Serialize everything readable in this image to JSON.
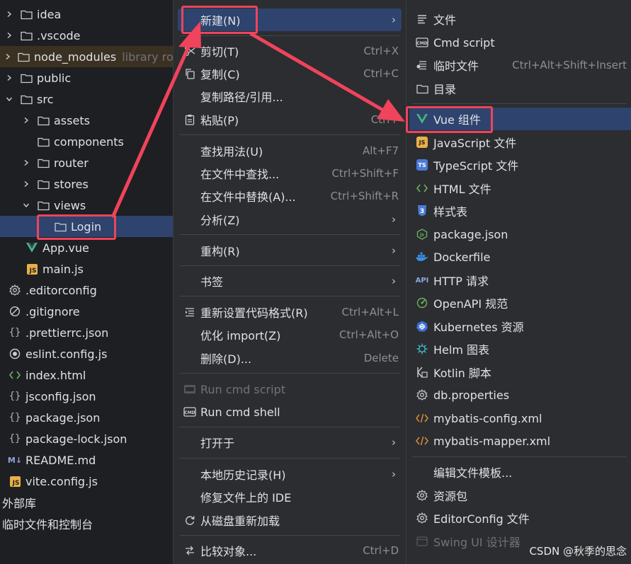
{
  "tree": {
    "items": [
      {
        "label": "idea",
        "type": "folder",
        "indent": 0,
        "expand": "collapsed"
      },
      {
        "label": ".vscode",
        "type": "folder",
        "indent": 0,
        "expand": "collapsed"
      },
      {
        "label": "node_modules",
        "note": "library ro",
        "type": "folder",
        "indent": 0,
        "expand": "collapsed"
      },
      {
        "label": "public",
        "type": "folder",
        "indent": 0,
        "expand": "collapsed"
      },
      {
        "label": "src",
        "type": "folder",
        "indent": 0,
        "expand": "expanded"
      },
      {
        "label": "assets",
        "type": "folder",
        "indent": 1,
        "expand": "collapsed"
      },
      {
        "label": "components",
        "type": "folder",
        "indent": 1,
        "expand": "none"
      },
      {
        "label": "router",
        "type": "folder",
        "indent": 1,
        "expand": "collapsed"
      },
      {
        "label": "stores",
        "type": "folder",
        "indent": 1,
        "expand": "collapsed"
      },
      {
        "label": "views",
        "type": "folder",
        "indent": 1,
        "expand": "expanded"
      },
      {
        "label": "Login",
        "type": "folder",
        "indent": 2,
        "expand": "none"
      },
      {
        "label": "App.vue",
        "type": "vue",
        "indent": 1,
        "expand": "none"
      },
      {
        "label": "main.js",
        "type": "js",
        "indent": 1,
        "expand": "none"
      },
      {
        "label": ".editorconfig",
        "type": "gear",
        "indent": 0,
        "expand": "none"
      },
      {
        "label": ".gitignore",
        "type": "ignore",
        "indent": 0,
        "expand": "none"
      },
      {
        "label": ".prettierrc.json",
        "type": "json",
        "indent": 0,
        "expand": "none"
      },
      {
        "label": "eslint.config.js",
        "type": "eslint",
        "indent": 0,
        "expand": "none"
      },
      {
        "label": "index.html",
        "type": "html",
        "indent": 0,
        "expand": "none"
      },
      {
        "label": "jsconfig.json",
        "type": "json",
        "indent": 0,
        "expand": "none"
      },
      {
        "label": "package.json",
        "type": "json",
        "indent": 0,
        "expand": "none"
      },
      {
        "label": "package-lock.json",
        "type": "json",
        "indent": 0,
        "expand": "none"
      },
      {
        "label": "README.md",
        "type": "md",
        "indent": 0,
        "expand": "none"
      },
      {
        "label": "vite.config.js",
        "type": "js",
        "indent": 0,
        "expand": "none"
      }
    ],
    "external_libraries": "外部库",
    "scratches": "临时文件和控制台"
  },
  "menu": {
    "new": "新建(N)",
    "cut": "剪切(T)",
    "cut_sc": "Ctrl+X",
    "copy": "复制(C)",
    "copy_sc": "Ctrl+C",
    "copy_path": "复制路径/引用...",
    "paste": "粘贴(P)",
    "paste_sc": "Ctrl+",
    "find_usages": "查找用法(U)",
    "find_usages_sc": "Alt+F7",
    "find_in_files": "在文件中查找...",
    "find_in_files_sc": "Ctrl+Shift+F",
    "replace_in_files": "在文件中替换(A)...",
    "replace_in_files_sc": "Ctrl+Shift+R",
    "analyze": "分析(Z)",
    "refactor": "重构(R)",
    "bookmarks": "书签",
    "reformat": "重新设置代码格式(R)",
    "reformat_sc": "Ctrl+Alt+L",
    "optimize_imports": "优化 import(Z)",
    "optimize_imports_sc": "Ctrl+Alt+O",
    "delete": "删除(D)...",
    "delete_sc": "Delete",
    "run_cmd_script": "Run cmd script",
    "run_cmd_shell": "Run cmd shell",
    "open_in": "打开于",
    "local_history": "本地历史记录(H)",
    "repair_ide": "修复文件上的 IDE",
    "reload": "从磁盘重新加载",
    "compare_with": "比较对象...",
    "compare_with_sc": "Ctrl+D",
    "arrow": "›"
  },
  "submenu": {
    "file": "文件",
    "cmd_script": "Cmd script",
    "scratch": "临时文件",
    "scratch_sc": "Ctrl+Alt+Shift+Insert",
    "directory": "目录",
    "vue": "Vue 组件",
    "javascript": "JavaScript 文件",
    "typescript": "TypeScript 文件",
    "html": "HTML 文件",
    "stylesheet": "样式表",
    "package_json": "package.json",
    "dockerfile": "Dockerfile",
    "http": "HTTP 请求",
    "openapi": "OpenAPI 规范",
    "kubernetes": "Kubernetes 资源",
    "helm": "Helm 图表",
    "kotlin": "Kotlin 脚本",
    "db_properties": "db.properties",
    "mybatis_config": "mybatis-config.xml",
    "mybatis_mapper": "mybatis-mapper.xml",
    "edit_templates": "编辑文件模板...",
    "resource_bundle": "资源包",
    "editorconfig": "EditorConfig 文件",
    "swing": "Swing UI 设计器"
  },
  "icons": {
    "js_badge": "JS",
    "ts_badge": "TS",
    "api_badge": "API",
    "md_badge": "M↓",
    "css_badge": "3",
    "cmd_badge": "CMD"
  },
  "colors": {
    "accent": "#2e436e",
    "annotation": "#f0435c",
    "vue": "#41b883",
    "js": "#e8b04a"
  },
  "watermark": "CSDN @秋季的思念"
}
